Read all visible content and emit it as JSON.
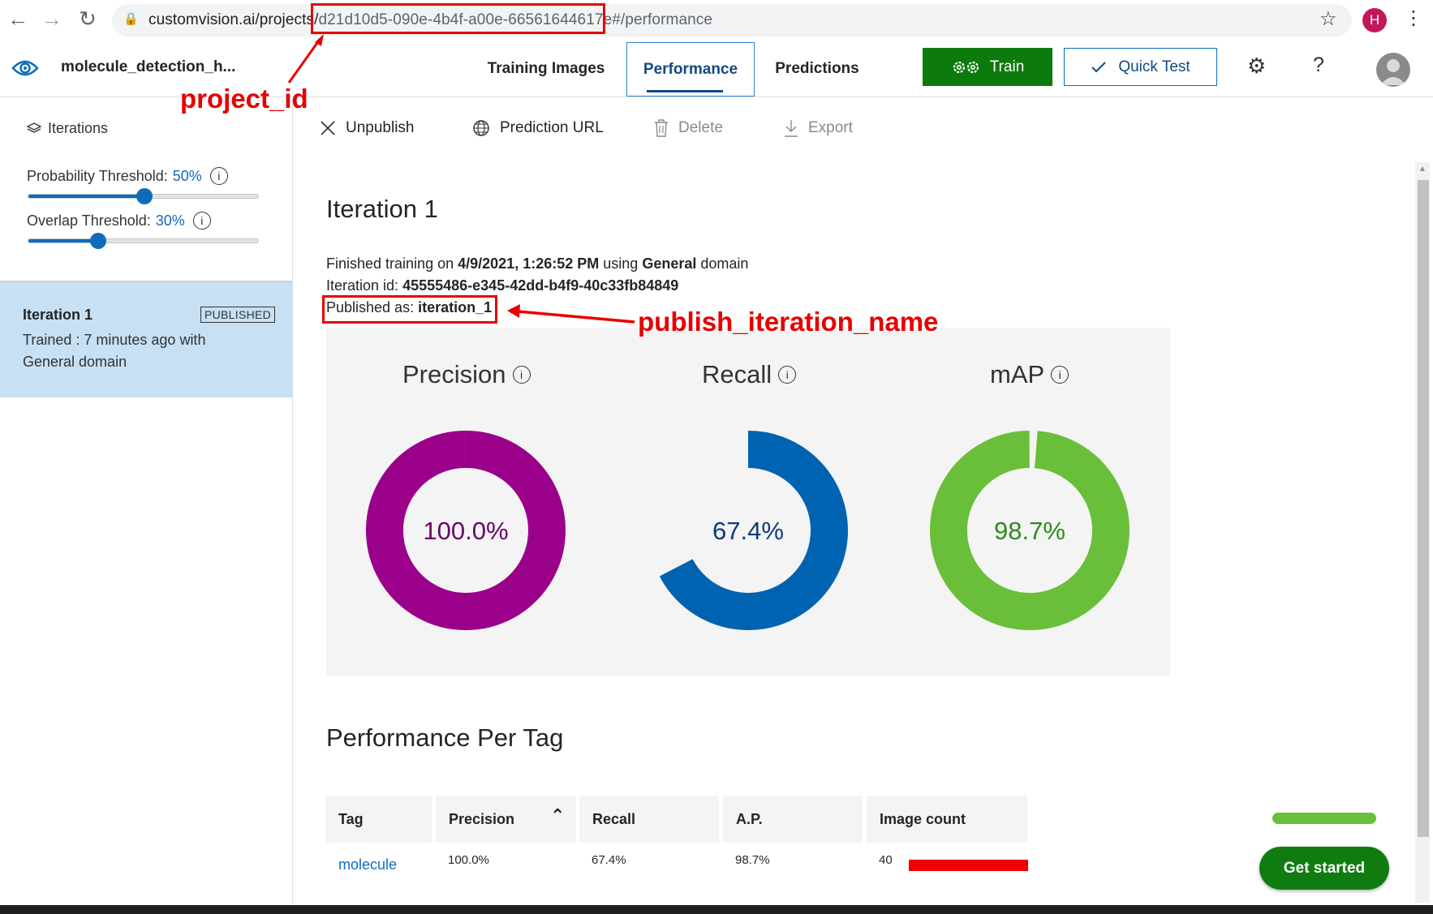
{
  "browser": {
    "url_host": "customvision.ai/projects/",
    "url_project_id": "d21d10d5-090e-4b4f-a00e-66561644617e",
    "url_suffix": "#/performance",
    "profile_initial": "H",
    "back_icon": "←",
    "forward_icon": "→",
    "reload_icon": "↻",
    "lock_icon": "🔒",
    "star_icon": "☆",
    "menu_icon": "⋮"
  },
  "header": {
    "project_name": "molecule_detection_h...",
    "tabs": [
      {
        "label": "Training Images"
      },
      {
        "label": "Performance"
      },
      {
        "label": "Predictions"
      }
    ],
    "train_label": "Train",
    "quick_test_label": "Quick Test",
    "settings_icon": "⚙",
    "help_icon": "?"
  },
  "sidebar": {
    "iterations_label": "Iterations",
    "probability_label": "Probability Threshold:",
    "probability_value": "50%",
    "probability_fraction": 0.5,
    "overlap_label": "Overlap Threshold:",
    "overlap_value": "30%",
    "overlap_fraction": 0.3,
    "iteration": {
      "name": "Iteration 1",
      "badge": "PUBLISHED",
      "description_line1": "Trained : 7 minutes ago with",
      "description_line2": "General domain"
    }
  },
  "toolbar": {
    "unpublish": "Unpublish",
    "prediction_url": "Prediction URL",
    "delete": "Delete",
    "export": "Export"
  },
  "main": {
    "title": "Iteration 1",
    "finished_prefix": "Finished training on",
    "finished_date": "4/9/2021, 1:26:52 PM",
    "finished_using": "using",
    "domain": "General",
    "domain_suffix": "domain",
    "iteration_id_label": "Iteration id:",
    "iteration_id": "45555486-e345-42dd-b4f9-40c33fb84849",
    "published_label": "Published as:",
    "published_name": "iteration_1",
    "info_icon": "i"
  },
  "charts": {
    "precision": {
      "title": "Precision",
      "value_label": "100.0%",
      "value": 100.0,
      "color": "#9b008b",
      "text_color": "#6a006a"
    },
    "recall": {
      "title": "Recall",
      "value_label": "67.4%",
      "value": 67.4,
      "color": "#0063b1",
      "text_color": "#0f3a7a"
    },
    "map": {
      "title": "mAP",
      "value_label": "98.7%",
      "value": 98.7,
      "color": "#6abf3a",
      "text_color": "#2e8a1d"
    }
  },
  "per_tag": {
    "title": "Performance Per Tag",
    "columns": [
      "Tag",
      "Precision",
      "Recall",
      "A.P.",
      "Image count"
    ],
    "sort_icon": "⌃",
    "rows": [
      {
        "tag": "molecule",
        "precision": "100.0%",
        "recall": "67.4%",
        "ap": "98.7%",
        "image_count": "40"
      }
    ]
  },
  "annotations": {
    "project_id_label": "project_id",
    "publish_name_label": "publish_iteration_name",
    "color": "#e80000"
  },
  "get_started": "Get started"
}
